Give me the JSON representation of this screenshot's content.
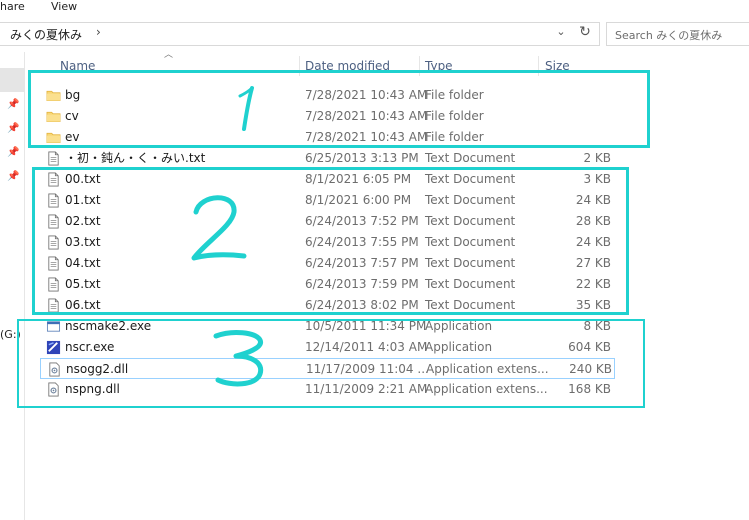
{
  "ribbon": {
    "tab_share": "hare",
    "tab_view": "View"
  },
  "address": {
    "path": "みくの夏休み",
    "separator": "›",
    "dropdown": "⌄",
    "refresh": "↻"
  },
  "search": {
    "placeholder": "Search みくの夏休み"
  },
  "nav": {
    "drive_label": "(G:)"
  },
  "columns": {
    "name": "Name",
    "date": "Date modified",
    "type": "Type",
    "size": "Size"
  },
  "files": [
    {
      "name": "bg",
      "date": "7/28/2021 10:43 AM",
      "type": "File folder",
      "size": "",
      "icon": "folder-icon"
    },
    {
      "name": "cv",
      "date": "7/28/2021 10:43 AM",
      "type": "File folder",
      "size": "",
      "icon": "folder-icon"
    },
    {
      "name": "ev",
      "date": "7/28/2021 10:43 AM",
      "type": "File folder",
      "size": "",
      "icon": "folder-icon"
    },
    {
      "name": "・初・鈍ん・く・みい.txt",
      "date": "6/25/2013 3:13 PM",
      "type": "Text Document",
      "size": "2 KB",
      "icon": "text-file-icon"
    },
    {
      "name": "00.txt",
      "date": "8/1/2021 6:05 PM",
      "type": "Text Document",
      "size": "3 KB",
      "icon": "text-file-icon"
    },
    {
      "name": "01.txt",
      "date": "8/1/2021 6:00 PM",
      "type": "Text Document",
      "size": "24 KB",
      "icon": "text-file-icon"
    },
    {
      "name": "02.txt",
      "date": "6/24/2013 7:52 PM",
      "type": "Text Document",
      "size": "28 KB",
      "icon": "text-file-icon"
    },
    {
      "name": "03.txt",
      "date": "6/24/2013 7:55 PM",
      "type": "Text Document",
      "size": "24 KB",
      "icon": "text-file-icon"
    },
    {
      "name": "04.txt",
      "date": "6/24/2013 7:57 PM",
      "type": "Text Document",
      "size": "27 KB",
      "icon": "text-file-icon"
    },
    {
      "name": "05.txt",
      "date": "6/24/2013 7:59 PM",
      "type": "Text Document",
      "size": "22 KB",
      "icon": "text-file-icon"
    },
    {
      "name": "06.txt",
      "date": "6/24/2013 8:02 PM",
      "type": "Text Document",
      "size": "35 KB",
      "icon": "text-file-icon"
    },
    {
      "name": "nscmake2.exe",
      "date": "10/5/2011 11:34 PM",
      "type": "Application",
      "size": "8 KB",
      "icon": "app-window-icon"
    },
    {
      "name": "nscr.exe",
      "date": "12/14/2011 4:03 AM",
      "type": "Application",
      "size": "604 KB",
      "icon": "app-blue-icon"
    },
    {
      "name": "nsogg2.dll",
      "date": "11/17/2009 11:04 ...",
      "type": "Application extens...",
      "size": "240 KB",
      "icon": "dll-gear-icon",
      "selected": true
    },
    {
      "name": "nspng.dll",
      "date": "11/11/2009 2:21 AM",
      "type": "Application extens...",
      "size": "168 KB",
      "icon": "dll-gear-icon"
    }
  ],
  "annotations": {
    "box1": "1",
    "box2": "2",
    "box3": "3",
    "color": "#1fd1cf"
  }
}
